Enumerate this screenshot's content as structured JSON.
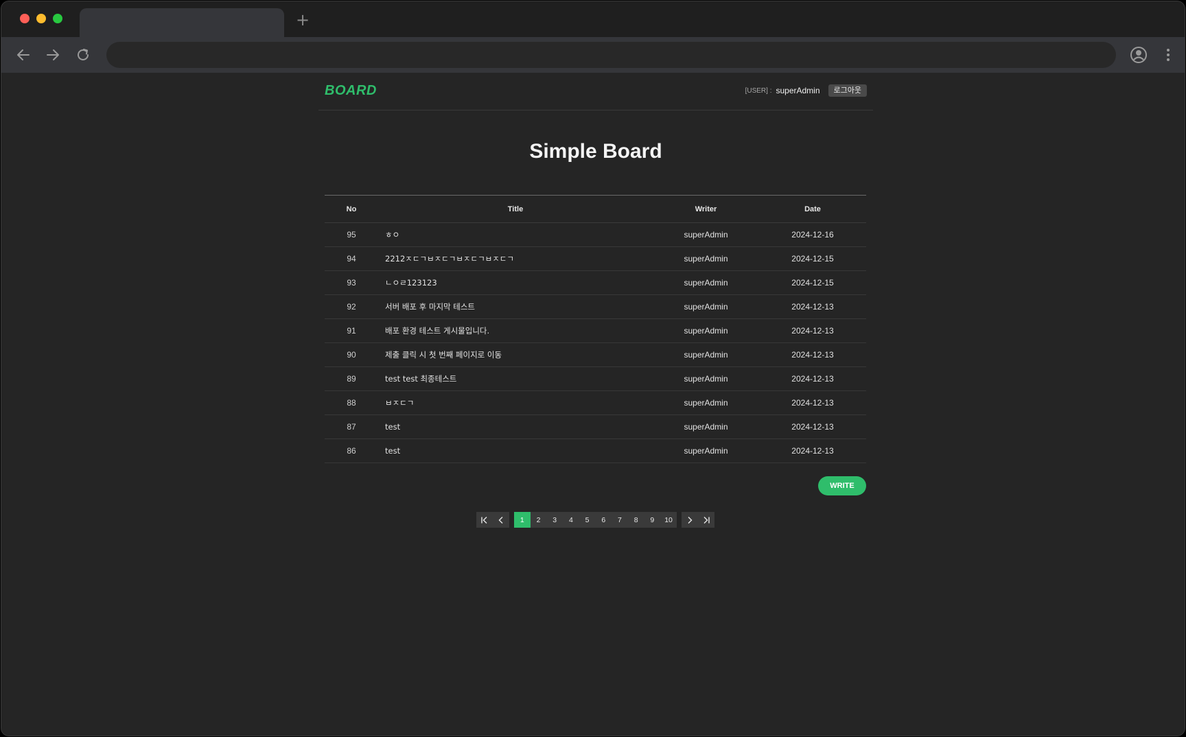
{
  "browser": {
    "new_tab_label": "+"
  },
  "header": {
    "logo": "BOARD",
    "user_label": "[USER] :",
    "user_name": "superAdmin",
    "logout_label": "로그아웃"
  },
  "page_title": "Simple Board",
  "table": {
    "columns": [
      "No",
      "Title",
      "Writer",
      "Date"
    ],
    "rows": [
      {
        "no": "95",
        "title": "ㅎㅇ",
        "writer": "superAdmin",
        "date": "2024-12-16"
      },
      {
        "no": "94",
        "title": "2212ㅈㄷㄱㅂㅈㄷㄱㅂㅈㄷㄱㅂㅈㄷㄱ",
        "writer": "superAdmin",
        "date": "2024-12-15"
      },
      {
        "no": "93",
        "title": "ㄴㅇㄹ123123",
        "writer": "superAdmin",
        "date": "2024-12-15"
      },
      {
        "no": "92",
        "title": "서버 배포 후 마지막 테스트",
        "writer": "superAdmin",
        "date": "2024-12-13"
      },
      {
        "no": "91",
        "title": "배포 환경 테스트 게시물입니다.",
        "writer": "superAdmin",
        "date": "2024-12-13"
      },
      {
        "no": "90",
        "title": "제출 클릭 시 첫 번째 페이지로 이동",
        "writer": "superAdmin",
        "date": "2024-12-13"
      },
      {
        "no": "89",
        "title": "test test 최종테스트",
        "writer": "superAdmin",
        "date": "2024-12-13"
      },
      {
        "no": "88",
        "title": "ㅂㅈㄷㄱ",
        "writer": "superAdmin",
        "date": "2024-12-13"
      },
      {
        "no": "87",
        "title": "test",
        "writer": "superAdmin",
        "date": "2024-12-13"
      },
      {
        "no": "86",
        "title": "test",
        "writer": "superAdmin",
        "date": "2024-12-13"
      }
    ]
  },
  "write_label": "WRITE",
  "pagination": {
    "pages": [
      "1",
      "2",
      "3",
      "4",
      "5",
      "6",
      "7",
      "8",
      "9",
      "10"
    ],
    "current": "1"
  },
  "colors": {
    "accent": "#2fbd6b",
    "background": "#252525"
  }
}
